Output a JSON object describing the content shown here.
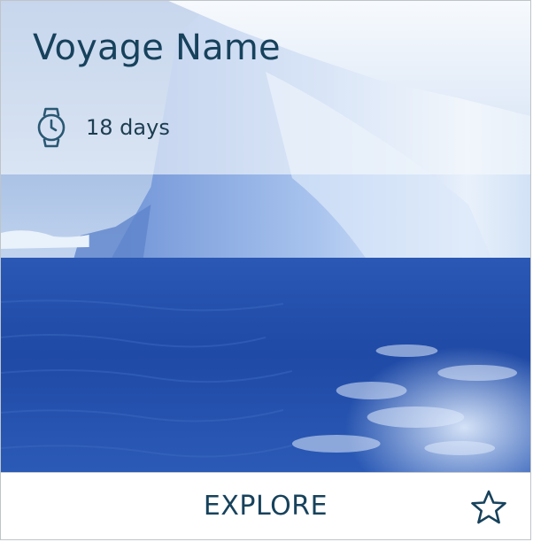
{
  "card": {
    "title": "Voyage Name",
    "duration": {
      "text": "18 days",
      "icon": "watch-icon"
    },
    "explore_label": "EXPLORE",
    "favorite_icon": "star-outline-icon",
    "image": "iceberg-in-ocean"
  },
  "colors": {
    "title_text": "#17425c",
    "body_text": "#1d3d50",
    "icon_stroke": "#2a5873",
    "overlay": "rgba(245,248,252,0.62)",
    "footer_bg": "#ffffff",
    "border": "#bfc4c8"
  }
}
